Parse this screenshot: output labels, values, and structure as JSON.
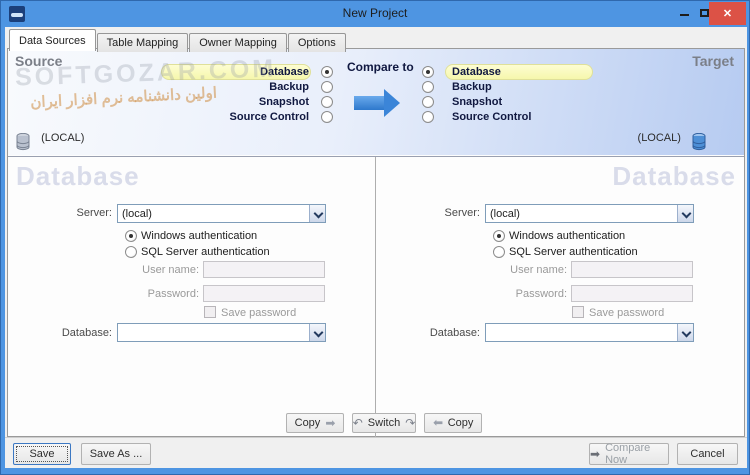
{
  "window": {
    "title": "New Project"
  },
  "icons": {
    "close": "✕",
    "arrow_right": "➡",
    "curved_left": "↶",
    "curved_right": "↷"
  },
  "watermark": {
    "line1": "SOFTGOZAR.COM",
    "line2": "اولین دانشنامه نرم افزار ایران"
  },
  "tabs": [
    "Data Sources",
    "Table Mapping",
    "Owner Mapping",
    "Options"
  ],
  "source": {
    "heading": "Source",
    "options": [
      "Database",
      "Backup",
      "Snapshot",
      "Source Control"
    ],
    "selected": "Database",
    "local_label": "(LOCAL)"
  },
  "target": {
    "heading": "Target",
    "options": [
      "Database",
      "Backup",
      "Snapshot",
      "Source Control"
    ],
    "selected": "Database",
    "local_label": "(LOCAL)"
  },
  "compare_to_label": "Compare to",
  "panel_left": {
    "heading": "Database",
    "server_label": "Server:",
    "server_value": "(local)",
    "auth_windows": "Windows authentication",
    "auth_sql": "SQL Server authentication",
    "auth_selected": "Windows authentication",
    "username_label": "User name:",
    "username_value": "",
    "password_label": "Password:",
    "password_value": "",
    "save_password_label": "Save password",
    "save_password_checked": false,
    "database_label": "Database:",
    "database_value": ""
  },
  "panel_right": {
    "heading": "Database",
    "server_label": "Server:",
    "server_value": "(local)",
    "auth_windows": "Windows authentication",
    "auth_sql": "SQL Server authentication",
    "auth_selected": "Windows authentication",
    "username_label": "User name:",
    "username_value": "",
    "password_label": "Password:",
    "password_value": "",
    "save_password_label": "Save password",
    "save_password_checked": false,
    "database_label": "Database:",
    "database_value": ""
  },
  "transfer": {
    "copy_label": "Copy",
    "switch_label": "Switch"
  },
  "footer": {
    "save": "Save",
    "save_as": "Save As ...",
    "compare_now": "Compare Now",
    "cancel": "Cancel"
  },
  "colors": {
    "titlebar": "#4e95e2",
    "close_button": "#dc5246",
    "highlight_pill": "#f9fab8",
    "top_gradient_end": "#b6cbf1"
  }
}
